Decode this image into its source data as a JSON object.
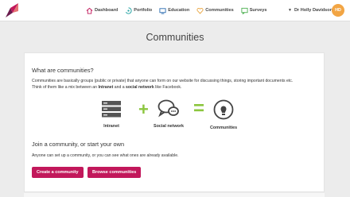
{
  "nav": {
    "items": [
      {
        "label": "Dashboard",
        "icon": "home-icon"
      },
      {
        "label": "Portfolio",
        "icon": "portfolio-icon"
      },
      {
        "label": "Education",
        "icon": "education-icon"
      },
      {
        "label": "Communities",
        "icon": "heart-icon"
      },
      {
        "label": "Surveys",
        "icon": "survey-icon"
      }
    ],
    "user_name": "Dr Holly Davidson",
    "avatar_initials": "HD"
  },
  "page": {
    "title": "Communities"
  },
  "about": {
    "heading": "What are communities?",
    "para_1": "Communities are basically groups (public or private) that anyone can form on our website for discussing things, storing important documents etc.",
    "para_2_start": "Think of them like a mix between an ",
    "bold_1": "Intranet",
    "para_2_mid": " and a ",
    "bold_2": "social network",
    "para_2_end": " like Facebook."
  },
  "illustration": {
    "intranet_label": "Intranet",
    "social_label": "Social network",
    "communities_label": "Communities",
    "plus_symbol": "+",
    "equals_symbol": "="
  },
  "join": {
    "heading": "Join a community, or start your own",
    "description": "Anyone can set up a community, or you can see what ones are already available.",
    "create_label": "Create a community",
    "browse_label": "Browse communities"
  },
  "colors": {
    "accent": "#c2185b",
    "green": "#8cc63f",
    "avatar": "#f2a544"
  }
}
